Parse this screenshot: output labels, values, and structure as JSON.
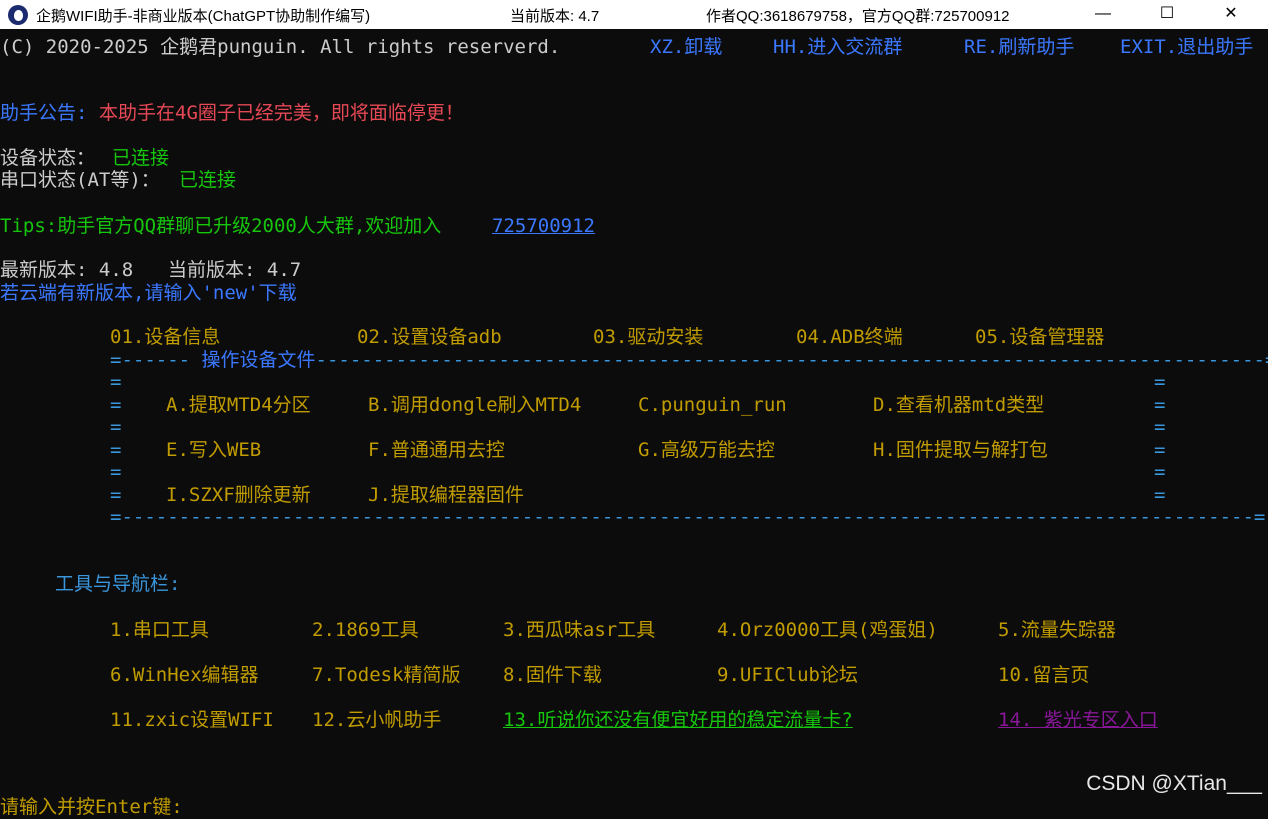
{
  "window": {
    "title": "企鹅WIFI助手-非商业版本(ChatGPT协助制作编写)",
    "version_label": "当前版本: 4.7",
    "author_label": "作者QQ:3618679758，官方QQ群:725700912",
    "minimize_glyph": "—",
    "maximize_glyph": "☐",
    "close_glyph": "✕"
  },
  "header": {
    "copyright": "(C) 2020-2025 企鹅君punguin. All rights reserverd.",
    "menu": [
      {
        "key": "XZ",
        "label": "XZ.卸载"
      },
      {
        "key": "HH",
        "label": "HH.进入交流群"
      },
      {
        "key": "RE",
        "label": "RE.刷新助手"
      },
      {
        "key": "EXIT",
        "label": "EXIT.退出助手"
      }
    ]
  },
  "notice": {
    "prefix": "助手公告:",
    "text": "本助手在4G圈子已经完美，即将面临停更！"
  },
  "status": {
    "device_label": "设备状态：",
    "device_value": "已连接",
    "serial_label": "串口状态(AT等)：",
    "serial_value": "已连接"
  },
  "tips": {
    "text": "Tips:助手官方QQ群聊已升级2000人大群,欢迎加入",
    "link": "725700912"
  },
  "version": {
    "latest_label": "最新版本: 4.8",
    "current_label": "当前版本: 4.7",
    "hint": "若云端有新版本,请输入'new'下载"
  },
  "top_menu": [
    "01.设备信息",
    "02.设置设备adb",
    "03.驱动安装",
    "04.ADB终端",
    "05.设备管理器"
  ],
  "file_box": {
    "title": "操作设备文件",
    "top_border": "=------ 操作设备文件----------------------------------------------------------------------------------=",
    "bottom_border": "=---------------------------------------------------------------------------------------------------=",
    "edge": "=",
    "rows": [
      [
        "A.提取MTD4分区",
        "B.调用dongle刷入MTD4",
        "C.punguin_run",
        "D.查看机器mtd类型"
      ],
      [
        "E.写入WEB",
        "F.普通通用去控",
        "G.高级万能去控",
        "H.固件提取与解打包"
      ],
      [
        "I.SZXF删除更新",
        "J.提取编程器固件"
      ]
    ]
  },
  "tools": {
    "heading": "工具与导航栏:",
    "rows": [
      [
        "1.串口工具",
        "2.1869工具",
        "3.西瓜味asr工具",
        "4.Orz0000工具(鸡蛋姐)",
        "5.流量失踪器"
      ],
      [
        "6.WinHex编辑器",
        "7.Todesk精简版",
        "8.固件下载",
        "9.UFIClub论坛",
        "10.留言页"
      ],
      [
        "11.zxic设置WIFI",
        "12.云小帆助手",
        "13.听说你还没有便宜好用的稳定流量卡?",
        "14. 紫光专区入口"
      ]
    ]
  },
  "prompt": "请输入并按Enter键:",
  "watermark": "CSDN @XTian___",
  "colors": {
    "background": "#0c0c0c",
    "default_text": "#cccccc",
    "blue": "#3b78ff",
    "red": "#e74856",
    "green": "#16c60c",
    "teal": "#3a96dd",
    "yellow": "#c19c00",
    "purple": "#881798"
  }
}
